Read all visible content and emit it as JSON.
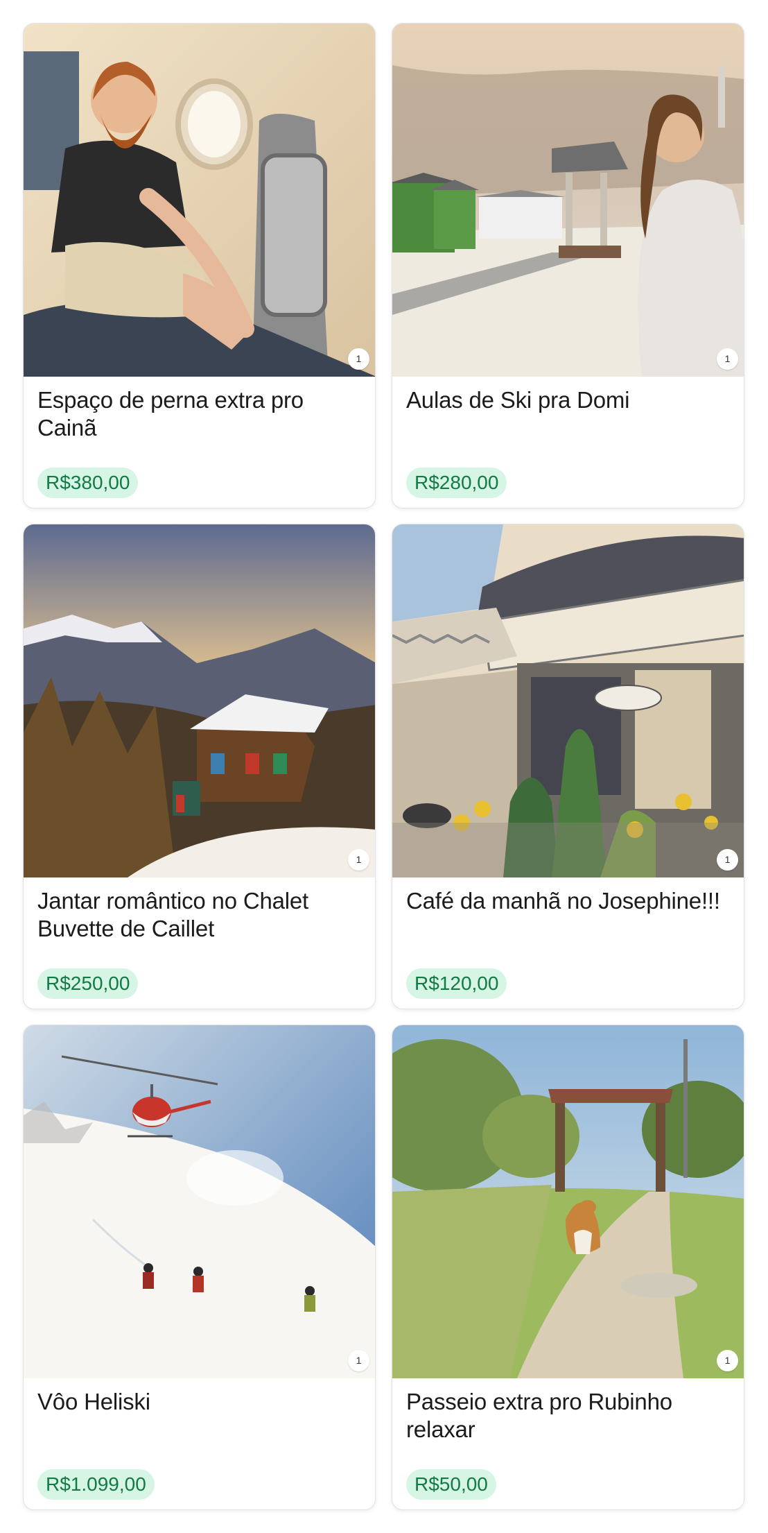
{
  "gifts": [
    {
      "title": "Espaço de perna extra pro Cainã",
      "price": "R$380,00",
      "image_count": "1",
      "image": "man-in-airplane-seat-watercolor"
    },
    {
      "title": "Aulas de Ski pra Domi",
      "price": "R$280,00",
      "image_count": "1",
      "image": "woman-in-snowy-village-watercolor"
    },
    {
      "title": "Jantar romântico no Chalet Buvette de Caillet",
      "price": "R$250,00",
      "image_count": "1",
      "image": "mountain-chalet-at-dusk-watercolor"
    },
    {
      "title": "Café da manhã no Josephine!!!",
      "price": "R$120,00",
      "image_count": "1",
      "image": "cafe-josephine-storefront-watercolor"
    },
    {
      "title": "Vôo Heliski",
      "price": "R$1.099,00",
      "image_count": "1",
      "image": "helicopter-skiers-slope-watercolor"
    },
    {
      "title": "Passeio extra pro Rubinho relaxar",
      "price": "R$50,00",
      "image_count": "1",
      "image": "dog-on-country-road-watercolor"
    }
  ],
  "colors": {
    "price_bg": "#d6f5e4",
    "price_text": "#127a45",
    "card_border": "#e3e3e3"
  }
}
